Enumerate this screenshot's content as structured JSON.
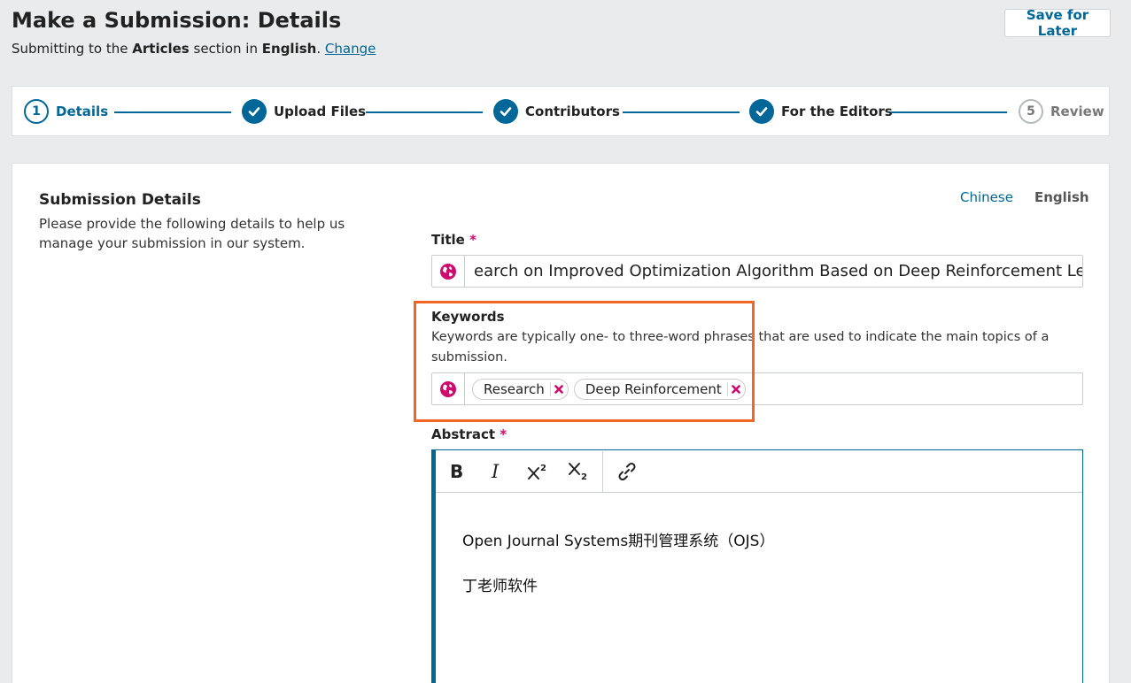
{
  "header": {
    "title": "Make a Submission: Details",
    "submitting_prefix": "Submitting to the",
    "section_name": "Articles",
    "section_mid": "section in",
    "language": "English",
    "period": ".",
    "change_link": "Change",
    "save_later": "Save for Later"
  },
  "steps": [
    {
      "number": "1",
      "label": "Details",
      "state": "active"
    },
    {
      "number": "",
      "label": "Upload Files",
      "state": "done"
    },
    {
      "number": "",
      "label": "Contributors",
      "state": "done"
    },
    {
      "number": "",
      "label": "For the Editors",
      "state": "done"
    },
    {
      "number": "5",
      "label": "Review",
      "state": "inactive"
    }
  ],
  "details": {
    "heading": "Submission Details",
    "description": "Please provide the following details to help us manage your submission in our system.",
    "lang_tabs": [
      "Chinese",
      "English"
    ],
    "title_label": "Title",
    "required_mark": "*",
    "title_value": "earch on Improved Optimization Algorithm Based on Deep Reinforcement Learning",
    "keywords_label": "Keywords",
    "keywords_desc": "Keywords are typically one- to three-word phrases that are used to indicate the main topics of a submission.",
    "keywords": [
      "Research",
      "Deep Reinforcement"
    ],
    "abstract_label": "Abstract",
    "abstract_lines": [
      "Open Journal Systems期刊管理系统（OJS）",
      "丁老师软件"
    ]
  },
  "colors": {
    "accent": "#006798",
    "required": "#d00a6c",
    "highlight": "#f26522"
  },
  "icons": [
    "globe-icon",
    "remove-tag-icon",
    "check-icon",
    "bold-icon",
    "italic-icon",
    "superscript-icon",
    "subscript-icon",
    "link-icon"
  ]
}
